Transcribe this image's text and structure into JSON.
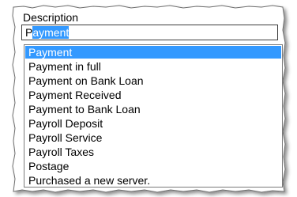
{
  "field": {
    "label": "Description",
    "value_first": "P",
    "value_rest": "ayment"
  },
  "dropdown": {
    "selected_index": 0,
    "options": [
      "Payment",
      "Payment in full",
      "Payment on Bank Loan",
      "Payment Received",
      "Payment to Bank Loan",
      "Payroll Deposit",
      "Payroll Service",
      "Payroll Taxes",
      "Postage",
      "Purchased a new server."
    ]
  },
  "colors": {
    "highlight": "#3399ff",
    "highlight_text": "#ffffff"
  }
}
